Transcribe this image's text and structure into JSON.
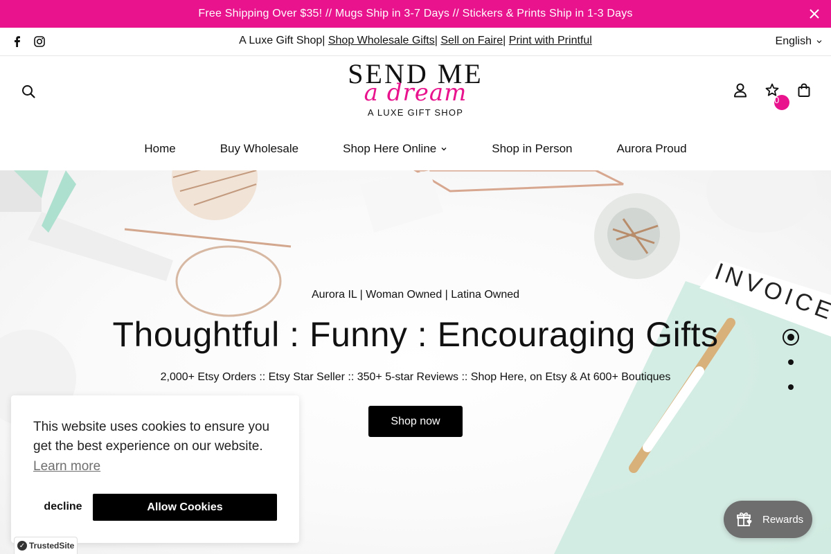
{
  "announcement": {
    "text": "Free Shipping Over $35! // Mugs Ship in 3-7 Days // Stickers & Prints Ship in 1-3 Days",
    "bg_color": "#e8138d"
  },
  "utility": {
    "prefix": "A Luxe Gift Shop|",
    "link1": "Shop Wholesale Gifts",
    "sep1": "|",
    "link2": "Sell on Faire",
    "sep2": "|",
    "link3": "Print with Printful",
    "language": "English",
    "social_icons": [
      "facebook-icon",
      "instagram-icon"
    ]
  },
  "logo": {
    "line1": "SEND ME",
    "line2": "a dream",
    "line3": "A LUXE GIFT SHOP"
  },
  "header": {
    "wishlist_count": "0",
    "icons": [
      "search-icon",
      "account-icon",
      "wishlist-star-icon",
      "cart-bag-icon"
    ]
  },
  "nav": {
    "items": [
      "Home",
      "Buy Wholesale",
      "Shop Here Online",
      "Shop in Person",
      "Aurora Proud"
    ]
  },
  "hero": {
    "subtitle": "Aurora IL | Woman Owned | Latina Owned",
    "title": "Thoughtful : Funny : Encouraging Gifts",
    "tagline": "2,000+ Etsy Orders :: Etsy Star Seller :: 350+ 5-star Reviews :: Shop Here, on Etsy & At 600+ Boutiques",
    "button": "Shop now",
    "invoice_text": "INVOICE",
    "slides": 3,
    "active_slide": 1
  },
  "cookie": {
    "message": "This website uses cookies to ensure you get the best experience on our website.",
    "learn_more": "Learn more",
    "decline": "decline",
    "allow": "Allow Cookies"
  },
  "trusted": {
    "label": "TrustedSite"
  },
  "rewards": {
    "label": "Rewards"
  }
}
